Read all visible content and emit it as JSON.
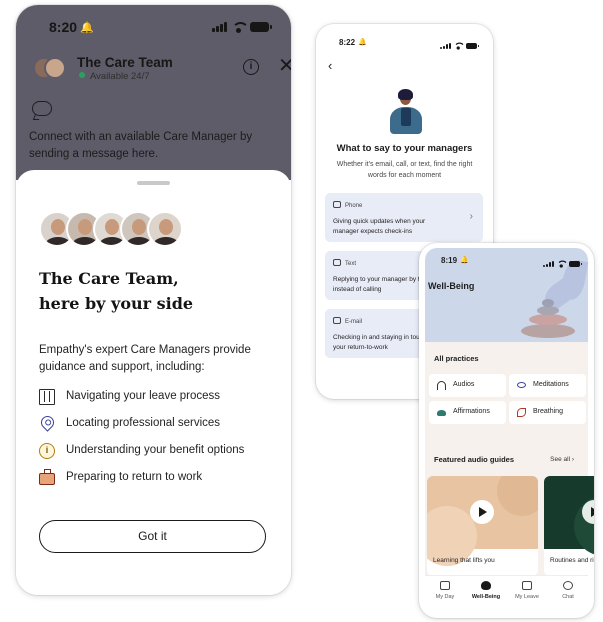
{
  "care_team_screen": {
    "status_time": "8:20",
    "team_name": "The Care Team",
    "availability": "Available 24/7",
    "connect_text": "Connect with an available Care Manager by sending a message here.",
    "headline_line1": "The Care Team,",
    "headline_line2": "here by your side",
    "description": "Empathy's expert Care Managers provide guidance and support, including:",
    "features": [
      {
        "label": "Navigating your leave process",
        "icon": "map-icon"
      },
      {
        "label": "Locating professional services",
        "icon": "location-pin-icon"
      },
      {
        "label": "Understanding your benefit options",
        "icon": "info-icon"
      },
      {
        "label": "Preparing to return to work",
        "icon": "briefcase-icon"
      }
    ],
    "button_label": "Got it",
    "colors": {
      "overlay": "#5e5c68",
      "status_dot": "#2aa063"
    }
  },
  "managers_screen": {
    "status_time": "8:22",
    "title": "What to say to your managers",
    "subtitle": "Whether it's email, call, or text, find the right words for each moment",
    "cards": [
      {
        "type": "Phone",
        "text": "Giving quick updates when your manager expects check-ins"
      },
      {
        "type": "Text",
        "text": "Replying to your manager by text instead of calling"
      },
      {
        "type": "E-mail",
        "text": "Checking in and staying in touch before your return-to-work"
      }
    ],
    "colors": {
      "card_bg": "#e8ecf7"
    }
  },
  "wellbeing_screen": {
    "status_time": "8:19",
    "title": "Well-Being",
    "all_practices_label": "All practices",
    "practices": [
      {
        "label": "Audios",
        "icon": "headphones-icon"
      },
      {
        "label": "Meditations",
        "icon": "eye-icon"
      },
      {
        "label": "Affirmations",
        "icon": "cloud-icon"
      },
      {
        "label": "Breathing",
        "icon": "leaf-icon"
      }
    ],
    "featured_label": "Featured audio guides",
    "see_all_label": "See all",
    "guides": [
      {
        "title": "Learning that lifts you"
      },
      {
        "title": "Routines and rituals to press reset"
      }
    ],
    "tabs": [
      {
        "label": "My Day"
      },
      {
        "label": "Well-Being"
      },
      {
        "label": "My Leave"
      },
      {
        "label": "Chat"
      }
    ],
    "colors": {
      "hero_bg": "#cdd7ea",
      "body_bg": "#f6f1ec",
      "guide_1": "#e9c4a3",
      "guide_2": "#163a2c"
    }
  }
}
